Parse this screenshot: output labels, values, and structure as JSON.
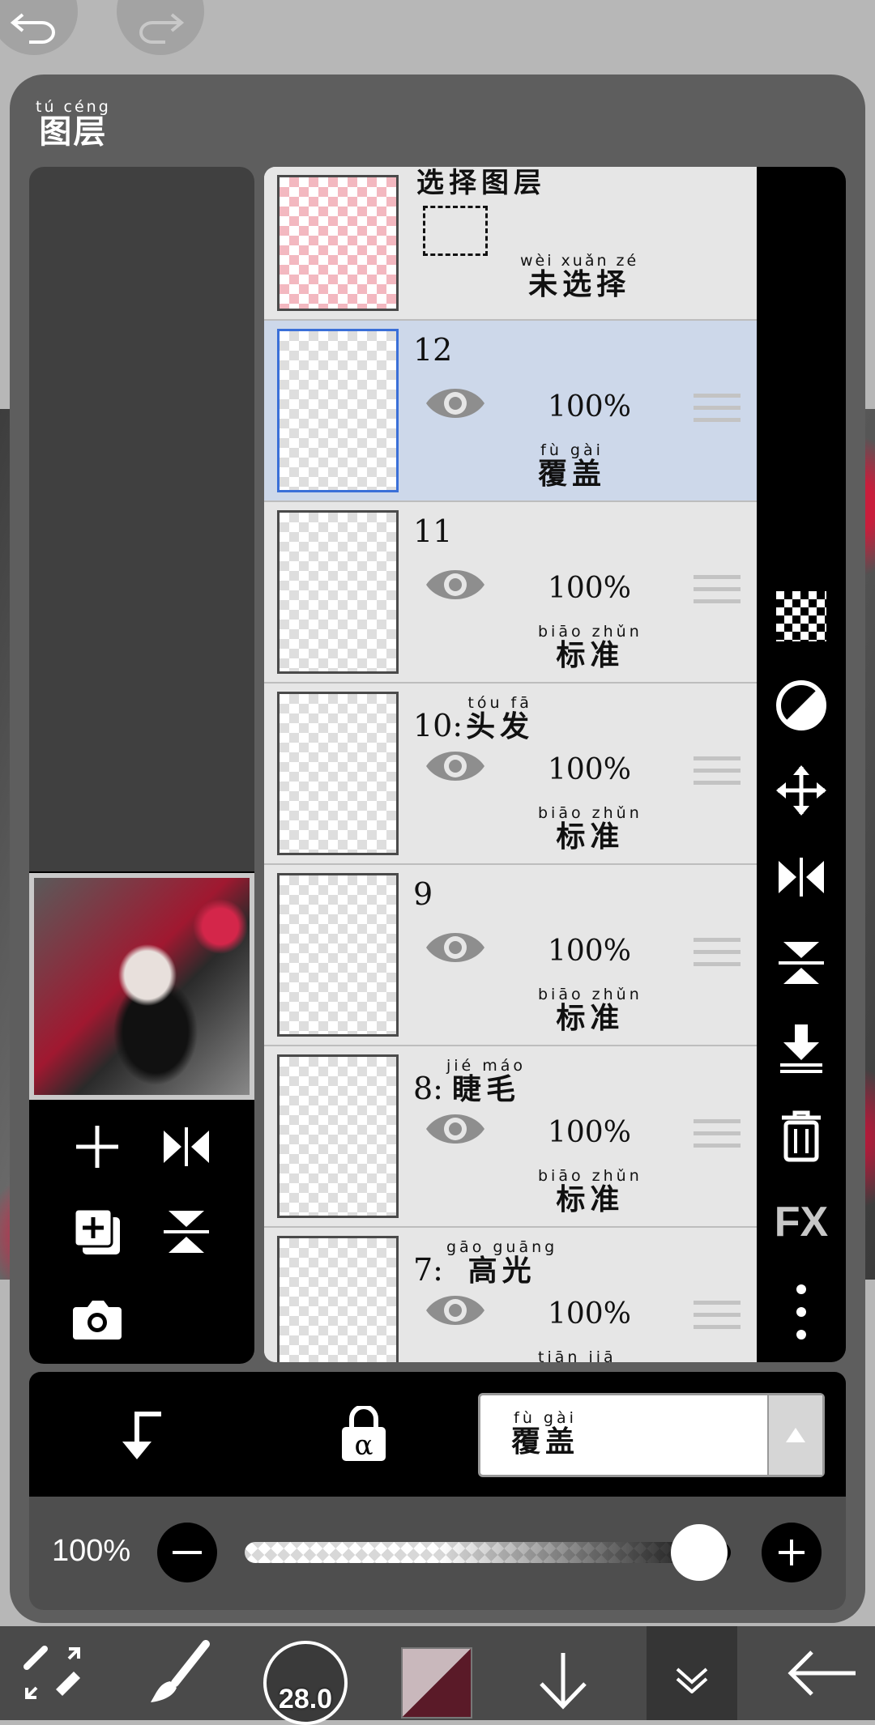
{
  "panel": {
    "title_pinyin": "tú céng",
    "title": "图层"
  },
  "selection_row": {
    "title": "选择图层",
    "status_pinyin": "wèi xuǎn zé",
    "status": "未选择"
  },
  "layers": [
    {
      "number": "12",
      "name_pinyin": "",
      "name": "",
      "opacity": "100%",
      "blend_pinyin": "fù gài",
      "blend": "覆盖",
      "selected": true
    },
    {
      "number": "11",
      "name_pinyin": "",
      "name": "",
      "opacity": "100%",
      "blend_pinyin": "biāo zhǔn",
      "blend": "标准",
      "selected": false
    },
    {
      "number": "10:",
      "name_pinyin": "tóu fā",
      "name": "头发",
      "opacity": "100%",
      "blend_pinyin": "biāo zhǔn",
      "blend": "标准",
      "selected": false
    },
    {
      "number": "9",
      "name_pinyin": "",
      "name": "",
      "opacity": "100%",
      "blend_pinyin": "biāo zhǔn",
      "blend": "标准",
      "selected": false
    },
    {
      "number": "8:",
      "name_pinyin": "jié máo",
      "name": "睫毛",
      "opacity": "100%",
      "blend_pinyin": "biāo zhǔn",
      "blend": "标准",
      "selected": false
    },
    {
      "number": "7:",
      "name_pinyin": "gāo guāng",
      "name": "高光",
      "opacity": "100%",
      "blend_pinyin": "tiān jiā",
      "blend": "",
      "selected": false
    }
  ],
  "right_toolbar": {
    "fx_label": "FX"
  },
  "blend_mode": {
    "pinyin": "fù gài",
    "value": "覆盖"
  },
  "opacity_control": {
    "label": "100%",
    "value": 1.0
  },
  "brush": {
    "size": "28.0"
  },
  "colors": {
    "panel": "#5e5e5e",
    "selected_row": "#cdd8ea",
    "accent_border": "#3a6fd8",
    "color_swatch": "#5a1a28"
  }
}
